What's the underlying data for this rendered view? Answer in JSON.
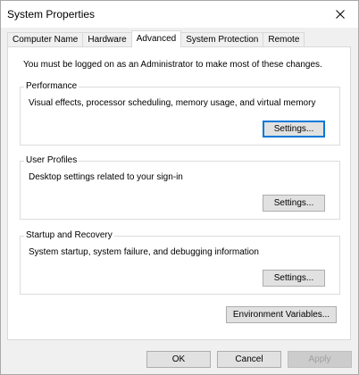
{
  "window": {
    "title": "System Properties"
  },
  "tabs": [
    {
      "label": "Computer Name",
      "active": false
    },
    {
      "label": "Hardware",
      "active": false
    },
    {
      "label": "Advanced",
      "active": true
    },
    {
      "label": "System Protection",
      "active": false
    },
    {
      "label": "Remote",
      "active": false
    }
  ],
  "advanced": {
    "admin_note": "You must be logged on as an Administrator to make most of these changes.",
    "performance": {
      "title": "Performance",
      "description": "Visual effects, processor scheduling, memory usage, and virtual memory",
      "button": "Settings..."
    },
    "user_profiles": {
      "title": "User Profiles",
      "description": "Desktop settings related to your sign-in",
      "button": "Settings..."
    },
    "startup_recovery": {
      "title": "Startup and Recovery",
      "description": "System startup, system failure, and debugging information",
      "button": "Settings..."
    },
    "env_button": "Environment Variables..."
  },
  "footer": {
    "ok": "OK",
    "cancel": "Cancel",
    "apply": "Apply"
  },
  "icons": {
    "close": "close-icon"
  },
  "colors": {
    "focus_border": "#0078d7",
    "window_bg": "#f0f0f0",
    "panel_bg": "#ffffff"
  }
}
